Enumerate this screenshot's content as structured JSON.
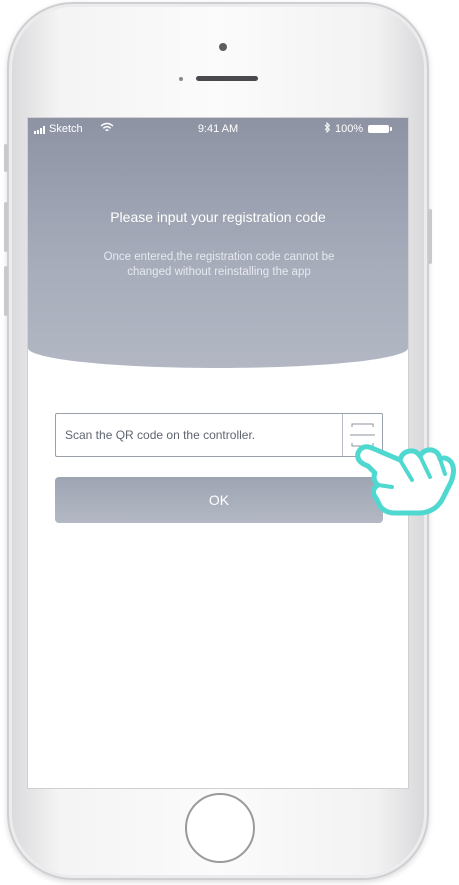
{
  "status_bar": {
    "carrier": "Sketch",
    "time": "9:41 AM",
    "battery_percent": "100%",
    "signal_icon": "signal-bars-icon",
    "wifi_icon": "wifi-icon",
    "bluetooth_icon": "bluetooth-icon",
    "battery_icon": "battery-icon"
  },
  "header": {
    "title": "Please input your registration code",
    "subtitle": "Once entered,the registration code cannot be changed without reinstalling the app"
  },
  "form": {
    "input_value": "Scan the QR code on the controller.",
    "scan_icon": "scan-qr-icon",
    "ok_label": "OK"
  },
  "overlay": {
    "hand_icon": "pointing-hand-icon"
  },
  "colors": {
    "header_bg": "#9aa0ae",
    "button_bg": "#aab0bd",
    "hand_accent": "#4fd8cf"
  }
}
